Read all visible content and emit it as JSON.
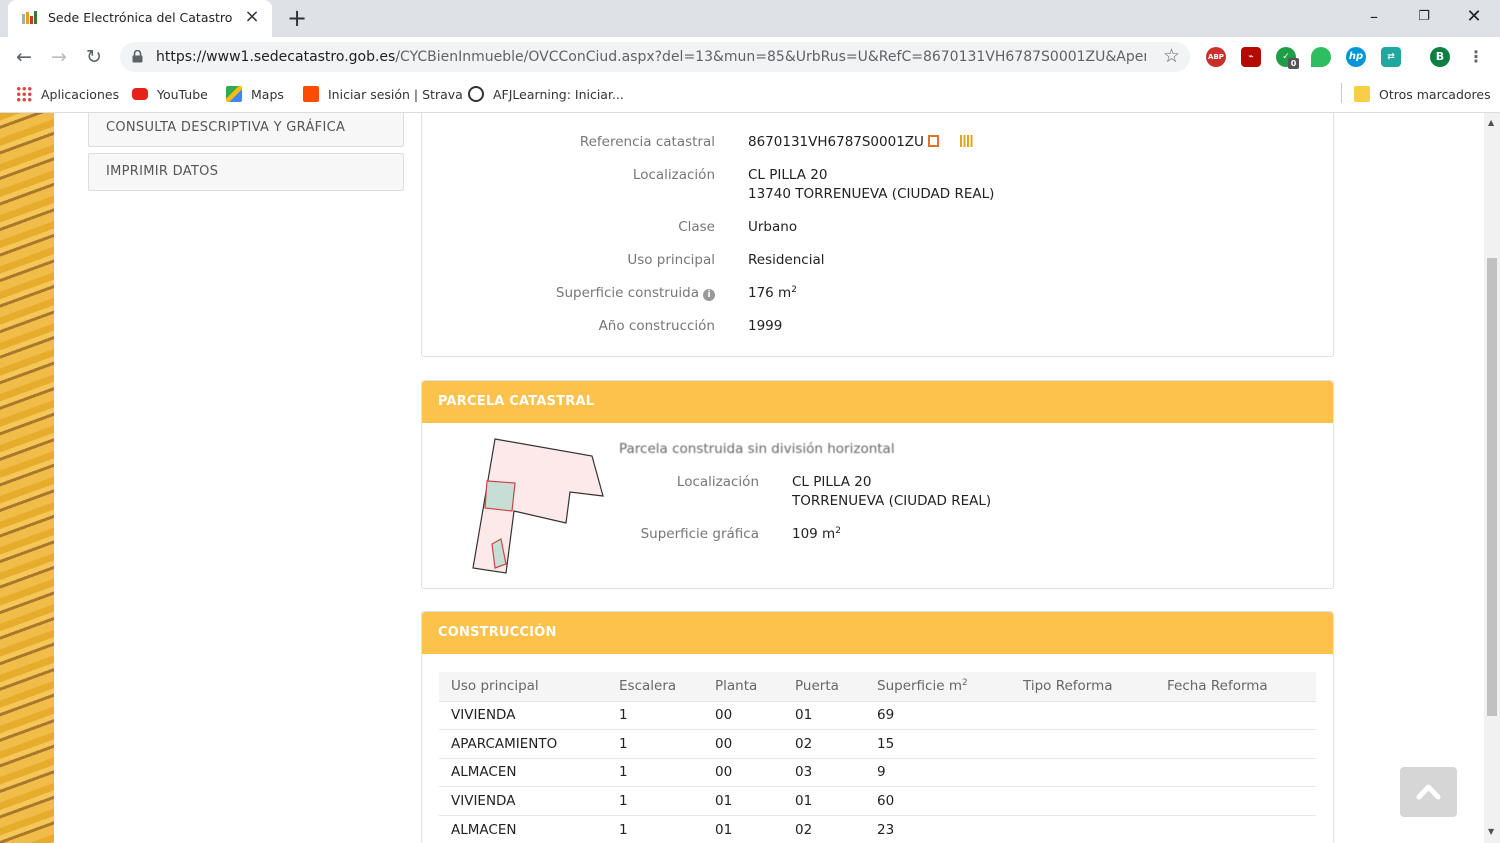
{
  "browser": {
    "tab_title": "Sede Electrónica del Catastro",
    "url_domain": "https://www1.sedecatastro.gob.es",
    "url_path": "/CYCBienInmueble/OVCConCiud.aspx?del=13&mun=85&UrbRus=U&RefC=8670131VH6787S0001ZU&Apeno...",
    "profile_initial": "B",
    "bookmarks": [
      "Aplicaciones",
      "YouTube",
      "Maps",
      "Iniciar sesión | Strava",
      "AFJLearning: Iniciar...",
      "Otros marcadores"
    ],
    "extensions": [
      "ABP",
      "adobe-pdf-icon",
      "todo-check-icon",
      "evernote-icon",
      "hp-icon",
      "sync-icon"
    ],
    "extension_badge": "0"
  },
  "sidebar": {
    "consulta": "CONSULTA DESCRIPTIVA Y GRÁFICA",
    "imprimir": "IMPRIMIR DATOS"
  },
  "inmueble": {
    "ref_label": "Referencia catastral",
    "ref_value": "8670131VH6787S0001ZU",
    "loc_label": "Localización",
    "loc_line1": "CL PILLA 20",
    "loc_line2": "13740 TORRENUEVA (CIUDAD REAL)",
    "clase_label": "Clase",
    "clase_value": "Urbano",
    "uso_label": "Uso principal",
    "uso_value": "Residencial",
    "sup_label": "Superficie construida",
    "sup_value": "176 m",
    "ano_label": "Año construcción",
    "ano_value": "1999"
  },
  "parcela": {
    "header": "PARCELA CATASTRAL",
    "subtitle": "Parcela construida sin división horizontal",
    "loc_label": "Localización",
    "loc_line1": "CL PILLA 20",
    "loc_line2": "TORRENUEVA (CIUDAD REAL)",
    "sup_label": "Superficie gráfica",
    "sup_value": "109 m"
  },
  "construccion": {
    "header": "CONSTRUCCIÓN",
    "columns": [
      "Uso principal",
      "Escalera",
      "Planta",
      "Puerta",
      "Superficie m",
      "Tipo Reforma",
      "Fecha Reforma"
    ],
    "rows": [
      [
        "VIVIENDA",
        "1",
        "00",
        "01",
        "69",
        "",
        ""
      ],
      [
        "APARCAMIENTO",
        "1",
        "00",
        "02",
        "15",
        "",
        ""
      ],
      [
        "ALMACEN",
        "1",
        "00",
        "03",
        "9",
        "",
        ""
      ],
      [
        "VIVIENDA",
        "1",
        "01",
        "01",
        "60",
        "",
        ""
      ],
      [
        "ALMACEN",
        "1",
        "01",
        "02",
        "23",
        "",
        ""
      ]
    ]
  },
  "colors": {
    "panel_header": "#fcc24c",
    "label": "#777777"
  },
  "sup_exponent": "2"
}
